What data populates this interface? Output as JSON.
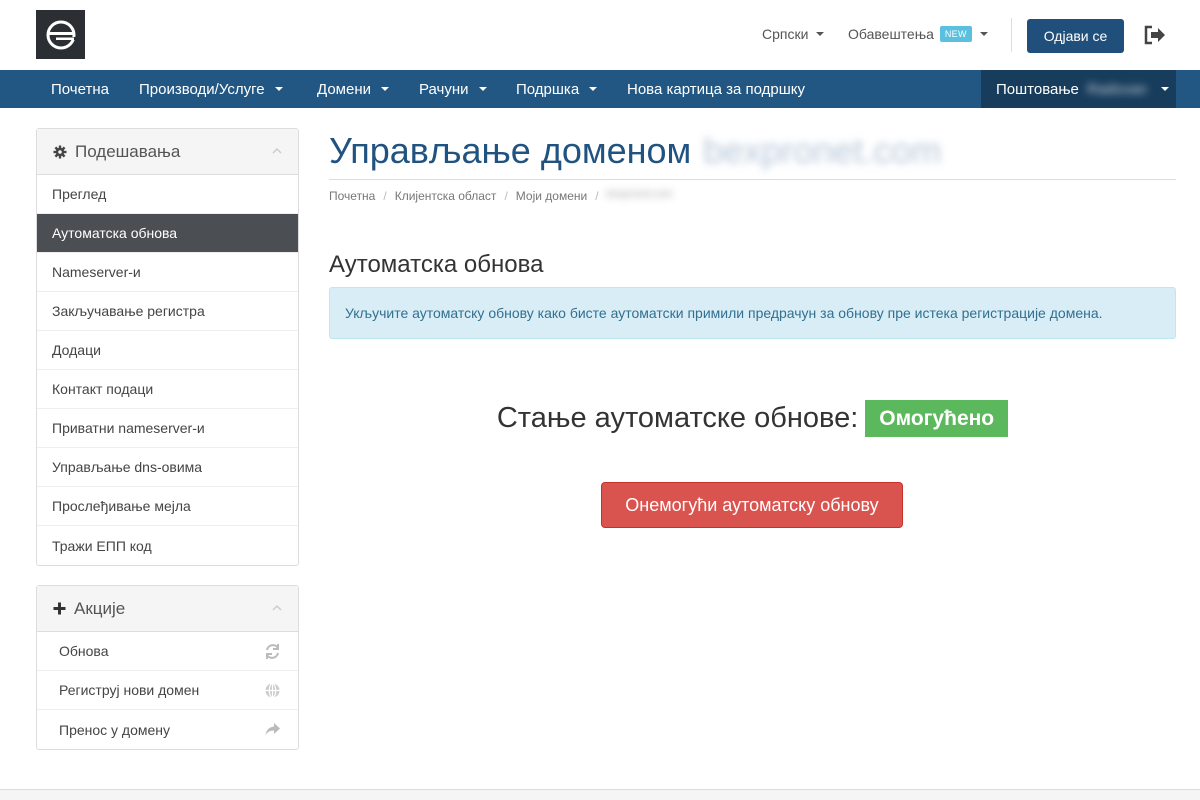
{
  "header": {
    "language_label": "Српски",
    "notifications_label": "Обавештења",
    "new_badge": "NEW",
    "logout_label": "Одјави се"
  },
  "nav": {
    "items": [
      {
        "label": "Почетна",
        "dropdown": false
      },
      {
        "label": "Производи/Услуге",
        "dropdown": true
      },
      {
        "label": "Домени",
        "dropdown": true
      },
      {
        "label": "Рачуни",
        "dropdown": true
      },
      {
        "label": "Подршка",
        "dropdown": true
      },
      {
        "label": "Нова картица за подршку",
        "dropdown": false
      }
    ],
    "greeting": "Поштовање",
    "username": "Radovan"
  },
  "sidebar": {
    "settings": {
      "title": "Подешавања",
      "icon": "gear-icon",
      "items": [
        {
          "label": "Преглед",
          "active": false
        },
        {
          "label": "Аутоматска обнова",
          "active": true
        },
        {
          "label": "Nameserver-и",
          "active": false
        },
        {
          "label": "Закључавање регистра",
          "active": false
        },
        {
          "label": "Додаци",
          "active": false
        },
        {
          "label": "Контакт подаци",
          "active": false
        },
        {
          "label": "Приватни nameserver-и",
          "active": false
        },
        {
          "label": "Управљање dns-овима",
          "active": false
        },
        {
          "label": "Прослеђивање мејла",
          "active": false
        },
        {
          "label": "Тражи ЕПП код",
          "active": false
        }
      ]
    },
    "actions": {
      "title": "Акције",
      "icon": "plus-icon",
      "items": [
        {
          "label": "Обнова",
          "icon": "refresh-icon"
        },
        {
          "label": "Региструј нови домен",
          "icon": "globe-icon"
        },
        {
          "label": "Пренос у домену",
          "icon": "share-arrow-icon"
        }
      ]
    }
  },
  "main": {
    "title": "Управљање доменом",
    "domain": "bexpronet.com",
    "breadcrumb": [
      "Почетна",
      "Клијентска област",
      "Моји домени",
      "bexpronet.com"
    ],
    "section_title": "Аутоматска обнова",
    "alert_text": "Укључите аутоматску обнову како бисте аутоматски примили предрачун за обнову пре истека регистрације домена.",
    "status_label": "Стање аутоматске обнове:",
    "status_value": "Омогућено",
    "disable_button": "Онемогући аутоматску обнову"
  },
  "colors": {
    "navbar": "#225783",
    "navbar_user": "#173c5c",
    "active_item": "#4b4e53",
    "status_enabled": "#5cb85c",
    "danger": "#d9534f",
    "alert_bg": "#d9edf7"
  }
}
